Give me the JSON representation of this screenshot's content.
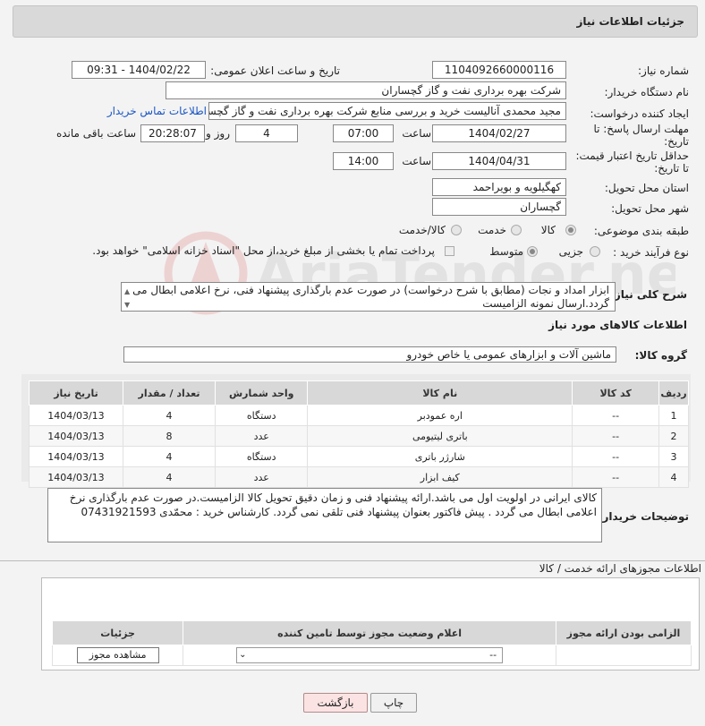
{
  "header": {
    "title": "جزئیات اطلاعات نیاز"
  },
  "form": {
    "need_number_label": "شماره نیاز:",
    "need_number": "1104092660000116",
    "announce_label": "تاریخ و ساعت اعلان عمومی:",
    "announce_value": "1404/02/22 - 09:31",
    "buyer_org_label": "نام دستگاه خریدار:",
    "buyer_org": "شرکت بهره برداری نفت و گاز گچساران",
    "requester_label": "ایجاد کننده درخواست:",
    "requester": "مجید محمدی آنالیست خرید و بررسی منابع شرکت بهره برداری نفت و گاز گچساران",
    "contact_link": "اطلاعات تماس خریدار",
    "deadline_label": "مهلت ارسال پاسخ: تا تاریخ:",
    "deadline_date": "1404/02/27",
    "time_label": "ساعت",
    "deadline_time": "07:00",
    "days_value": "4",
    "days_label": "روز و",
    "remaining_time": "20:28:07",
    "remaining_label": "ساعت باقی مانده",
    "min_price_label": "حداقل تاریخ اعتبار قیمت: تا تاریخ:",
    "min_price_date": "1404/04/31",
    "min_price_time": "14:00",
    "province_label": "استان محل تحویل:",
    "province": "کهگیلویه و بویراحمد",
    "city_label": "شهر محل تحویل:",
    "city": "گچساران",
    "category_label": "طبقه بندی موضوعی:",
    "category_options": [
      "کالا",
      "خدمت",
      "کالا/خدمت"
    ],
    "category_selected": "کالا",
    "process_label": "نوع فرآیند خرید :",
    "process_options": [
      "جزیی",
      "متوسط"
    ],
    "process_selected": "متوسط",
    "payment_note": "پرداخت تمام یا بخشی از مبلغ خرید،از محل \"اسناد خزانه اسلامی\" خواهد بود.",
    "summary_label": "شرح کلی نیاز:",
    "summary_line1": "ابزار امداد و نجات (مطابق با شرح درخواست) در صورت عدم بارگذاری پیشنهاد فنی، نرخ اعلامی ابطال می",
    "summary_line2": "گردد.ارسال نمونه الزامیست"
  },
  "goods": {
    "section_title": "اطلاعات کالاهای مورد نیاز",
    "group_label": "گروه کالا:",
    "group_value": "ماشین آلات و ابزارهای عمومی یا خاص خودرو",
    "columns": [
      "ردیف",
      "کد کالا",
      "نام کالا",
      "واحد شمارش",
      "تعداد / مقدار",
      "تاریخ نیاز"
    ],
    "rows": [
      [
        "1",
        "--",
        "اره عمودبر",
        "دستگاه",
        "4",
        "1404/03/13"
      ],
      [
        "2",
        "--",
        "باتری لیتیومی",
        "عدد",
        "8",
        "1404/03/13"
      ],
      [
        "3",
        "--",
        "شارژر باتری",
        "دستگاه",
        "4",
        "1404/03/13"
      ],
      [
        "4",
        "--",
        "کیف ابزار",
        "عدد",
        "4",
        "1404/03/13"
      ]
    ]
  },
  "buyer_notes": {
    "label": "توضیحات خریدار:",
    "line1": "کالای ایرانی در اولویت اول می باشد.ارائه پیشنهاد فنی و زمان دقیق تحویل کالا الزامیست.در صورت عدم بارگذاری نرخ",
    "line2": "اعلامی ابطال می گردد . پیش فاکتور بعنوان پیشنهاد  فنی تلقی نمی گردد. کارشناس خرید : محمّدی  07431921593"
  },
  "licenses": {
    "section_title": "اطلاعات مجوزهای ارائه خدمت / کالا",
    "columns": [
      "الزامی بودن ارائه مجوز",
      "اعلام وضعیت مجوز توسط تامین کننده",
      "جزئیات"
    ],
    "select_value": "--",
    "view_button": "مشاهده مجوز"
  },
  "actions": {
    "print": "چاپ",
    "back": "بازگشت"
  },
  "watermark_text": "AriaTender.neT"
}
